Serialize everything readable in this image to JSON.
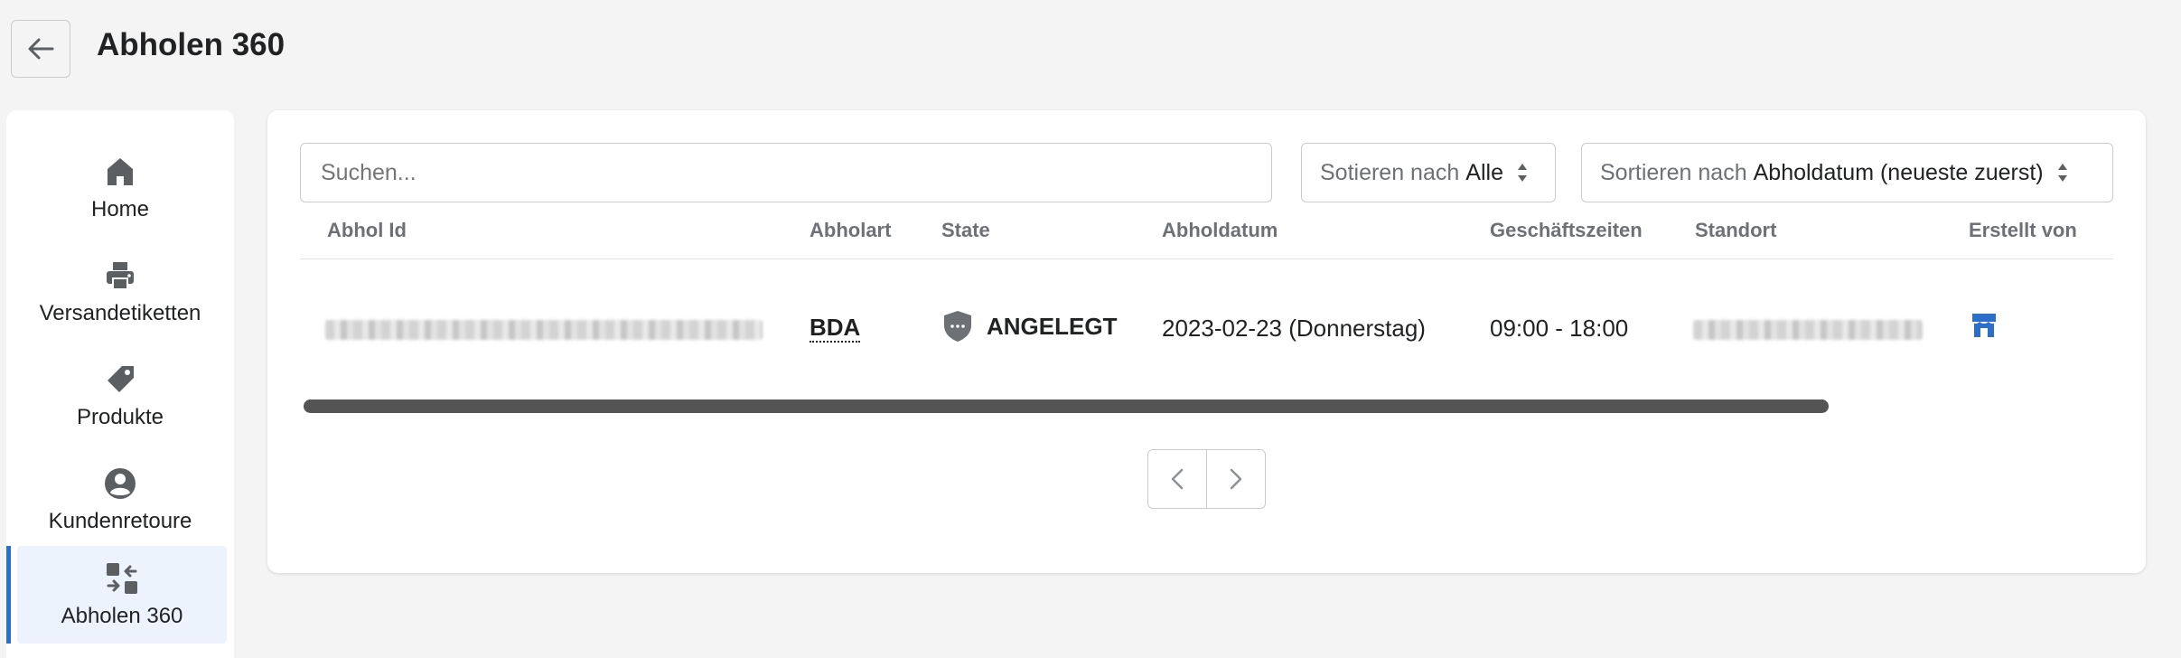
{
  "header": {
    "title": "Abholen 360",
    "back_icon": "arrow-left-icon"
  },
  "sidebar": {
    "items": [
      {
        "label": "Home",
        "icon": "home-icon"
      },
      {
        "label": "Versandetiketten",
        "icon": "printer-icon"
      },
      {
        "label": "Produkte",
        "icon": "tag-icon"
      },
      {
        "label": "Kundenretoure",
        "icon": "user-circle-icon"
      },
      {
        "label": "Abholen 360",
        "icon": "exchange-icon",
        "active": true
      }
    ],
    "active_color": "#2c6ecb"
  },
  "toolbar": {
    "search_placeholder": "Suchen...",
    "filter_prefix": "Sotieren nach",
    "filter_value": "Alle",
    "sort_prefix": "Sortieren nach",
    "sort_value": "Abholdatum (neueste zuerst)"
  },
  "table": {
    "columns": [
      "Abhol Id",
      "Abholart",
      "State",
      "Abholdatum",
      "Geschäftszeiten",
      "Standort",
      "Erstellt von"
    ],
    "rows": [
      {
        "abhol_id": "",
        "abholart": "BDA",
        "state": "ANGELEGT",
        "state_icon": "shield-icon",
        "abholdatum": "2023-02-23 (Donnerstag)",
        "geschaeftszeiten": "09:00 - 18:00",
        "standort": "",
        "erstellt_von_icon": "store-icon"
      }
    ]
  },
  "pagination": {
    "prev_icon": "chevron-left-icon",
    "next_icon": "chevron-right-icon"
  }
}
